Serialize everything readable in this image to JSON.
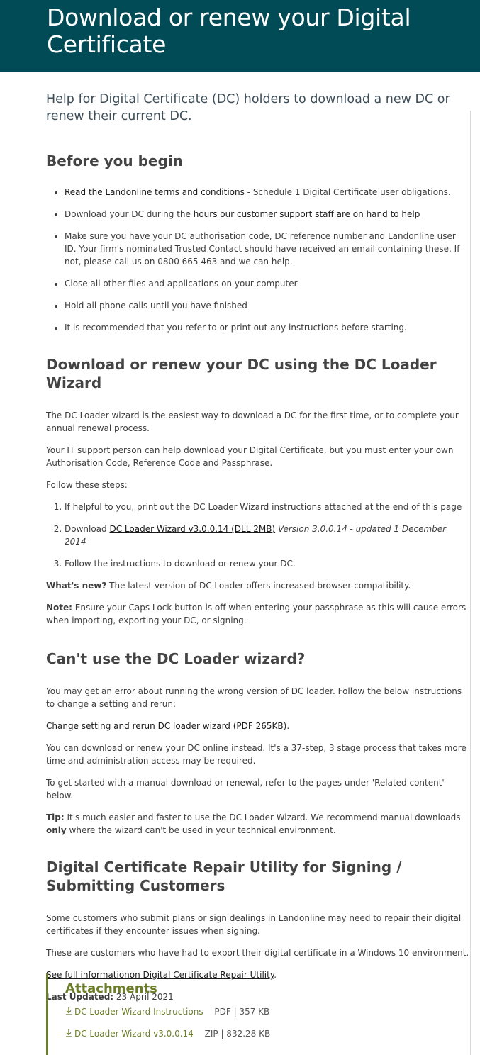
{
  "header": {
    "title_line1": "Download or renew your Digital",
    "title_line2": "Certificate"
  },
  "lead": "Help for Digital Certificate (DC) holders to download a new DC or renew their current DC.",
  "before": {
    "heading": "Before you begin",
    "item1_link": "Read the Landonline terms and conditions",
    "item1_text": " - Schedule 1 Digital Certificate user obligations.",
    "item2_text": "Download your DC during the ",
    "item2_link": "hours our customer support staff are on hand to help",
    "item3": "Make sure you have your DC authorisation code, DC reference number and Landonline user ID. Your firm's nominated Trusted Contact should have received an email containing these. If not, please call us on 0800 665 463 and we can help.",
    "item4": "Close all other files and applications on your computer",
    "item5": "Hold all phone calls until you have finished",
    "item6": "It is recommended that you refer to or print out any instructions before starting."
  },
  "wizard": {
    "heading": "Download or renew your DC using the DC Loader Wizard",
    "p1": "The DC Loader wizard is the easiest way to download a DC for the first time, or to complete your annual renewal process.",
    "p2": "Your IT support person can help download your Digital Certificate, but you must enter your own Authorisation Code, Reference Code and Passphrase.",
    "p3": "Follow these steps:",
    "step1": "If helpful to you, print out the DC Loader Wizard instructions attached at the end of this page",
    "step2_text": "Download ",
    "step2_link": "DC Loader Wizard v3.0.0.14 (DLL 2MB)",
    "step2_version": "Version 3.0.0.14 - updated 1 December 2014",
    "step3": "Follow the instructions to download or renew your DC.",
    "whatsnew_label": "What's new?",
    "whatsnew_text": " The latest version of DC Loader offers increased browser compatibility.",
    "note_label": "Note:",
    "note_text": " Ensure your Caps Lock button is off when entering your passphrase as this will cause errors when importing, exporting your DC, or signing."
  },
  "cant": {
    "heading": "Can't use the DC Loader wizard?",
    "p1": "You may get an error about running the wrong version of DC loader. Follow the below instructions to change a setting and rerun:",
    "link": "Change setting and rerun DC loader wizard (PDF 265KB)",
    "link_suffix": ".",
    "p2": "You can download or renew your DC online instead. It's a 37-step, 3 stage process that takes more time and administration access may be required.",
    "p3": "To get started with a manual download or renewal, refer to the pages under 'Related content' below.",
    "tip_label": "Tip:",
    "tip_text1": " It's much easier and faster to use the DC Loader Wizard. We recommend manual downloads ",
    "tip_only": "only",
    "tip_text2": " where the wizard can't be used in your technical environment."
  },
  "repair": {
    "heading": "Digital Certificate Repair Utility for Signing / Submitting Customers",
    "p1": "Some customers who submit plans or sign dealings in Landonline may need to repair their digital certificates if they encounter issues when signing.",
    "p2": "These are customers who have had to export their digital certificate in a Windows 10 environment.",
    "link": "See full informationon Digital Certificate Repair Utility",
    "link_suffix": ".",
    "updated_label": "Last Updated:",
    "updated_value": " 23 April 2021"
  },
  "attachments": {
    "title": "Attachments",
    "files": [
      {
        "name": "DC Loader Wizard Instructions",
        "meta": "PDF | 357 KB"
      },
      {
        "name": "DC Loader Wizard v3.0.0.14",
        "meta": "ZIP | 832.28 KB"
      }
    ]
  },
  "colors": {
    "header_bg": "#004b55",
    "attachment_accent": "#6b7d2a"
  }
}
